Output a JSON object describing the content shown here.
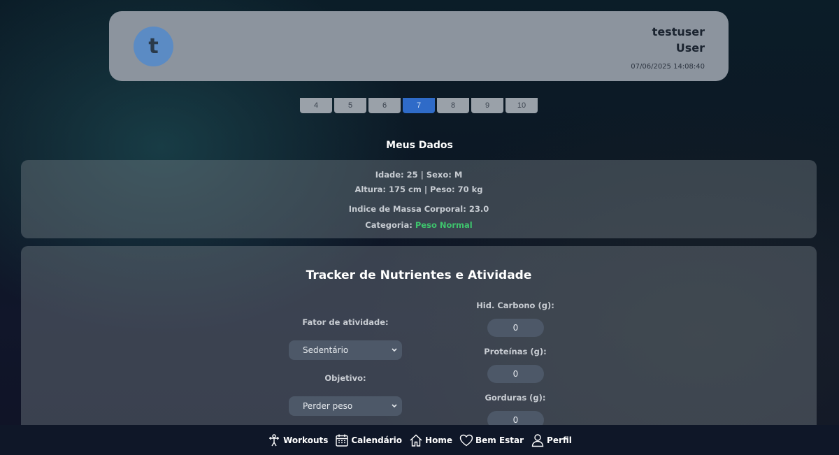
{
  "header": {
    "avatar_letter": "t",
    "username": "testuser",
    "role": "User",
    "timestamp": "07/06/2025 14:08:40"
  },
  "day_selector": {
    "days": [
      "4",
      "5",
      "6",
      "7",
      "8",
      "9",
      "10"
    ],
    "active_day": "7"
  },
  "my_data": {
    "title": "Meus Dados",
    "line1": "Idade: 25 | Sexo: M",
    "line2": "Altura: 175 cm | Peso: 70 kg",
    "bmi": "Indice de Massa Corporal: 23.0",
    "category_label": "Categoria:",
    "category_value": "Peso Normal",
    "category_color": "#3ec46d"
  },
  "tracker": {
    "title": "Tracker de Nutrientes e Atividade",
    "activity_label": "Fator de atividade:",
    "activity_value": "Sedentário",
    "goal_label": "Objetivo:",
    "goal_value": "Perder peso",
    "carbs_label": "Hid. Carbono (g):",
    "carbs_value": "0",
    "protein_label": "Proteínas (g):",
    "protein_value": "0",
    "fat_label": "Gorduras (g):",
    "fat_value": "0"
  },
  "nav": {
    "items": [
      {
        "label": "Workouts",
        "icon": "dumbbell-icon"
      },
      {
        "label": "Calendário",
        "icon": "calendar-icon"
      },
      {
        "label": "Home",
        "icon": "home-icon"
      },
      {
        "label": "Bem Estar",
        "icon": "heart-icon"
      },
      {
        "label": "Perfil",
        "icon": "user-icon"
      }
    ]
  },
  "colors": {
    "accent": "#2f6bc8",
    "header_card": "#8c949e",
    "avatar": "#5b8bc4"
  }
}
